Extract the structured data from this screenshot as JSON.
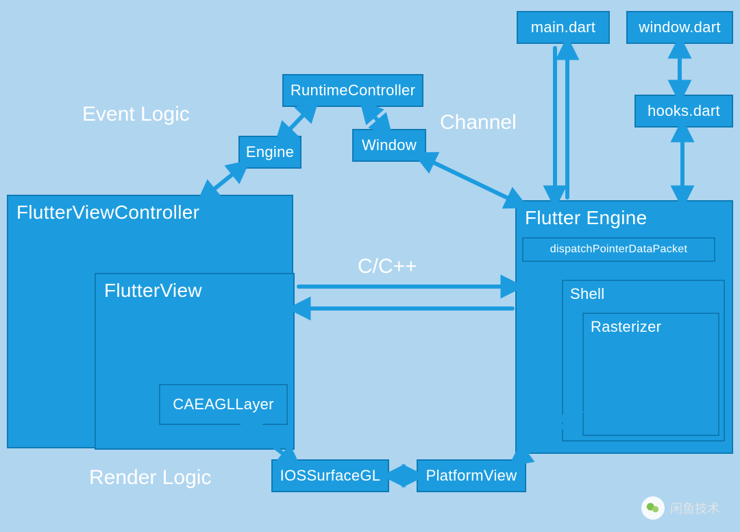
{
  "labels": {
    "event_logic": "Event Logic",
    "render_logic": "Render Logic",
    "channel": "Channel",
    "ccpp": "C/C++"
  },
  "nodes": {
    "flutter_view_controller": "FlutterViewController",
    "flutter_view": "FlutterView",
    "caeagllayer": "CAEAGLLayer",
    "engine": "Engine",
    "runtime_controller": "RuntimeController",
    "window": "Window",
    "iosurfacegl": "IOSSurfaceGL",
    "platform_view": "PlatformView",
    "flutter_engine": "Flutter Engine",
    "dispatch_pointer": "dispatchPointerDataPacket",
    "shell": "Shell",
    "rasterizer": "Rasterizer",
    "main_dart": "main.dart",
    "window_dart": "window.dart",
    "hooks_dart": "hooks.dart"
  },
  "watermark": "闲鱼技术",
  "colors": {
    "bg": "#b0d5ef",
    "block": "#1c9cdf",
    "border": "#0f7ab5",
    "text": "#ffffff"
  },
  "edges": [
    {
      "from": "flutter_view_controller",
      "to": "engine",
      "bidir": true
    },
    {
      "from": "engine",
      "to": "runtime_controller",
      "bidir": true
    },
    {
      "from": "runtime_controller",
      "to": "window",
      "bidir": true
    },
    {
      "from": "window",
      "to": "flutter_engine",
      "bidir": true,
      "label": "Channel"
    },
    {
      "from": "flutter_view",
      "to": "flutter_engine",
      "bidir": true,
      "label": "C/C++"
    },
    {
      "from": "caeagllayer",
      "to": "iosurfacegl",
      "bidir": true
    },
    {
      "from": "iosurfacegl",
      "to": "platform_view",
      "bidir": true
    },
    {
      "from": "platform_view",
      "to": "shell",
      "bidir": true
    },
    {
      "from": "main_dart",
      "to": "flutter_engine",
      "bidir": true
    },
    {
      "from": "window_dart",
      "to": "hooks_dart",
      "bidir": true
    },
    {
      "from": "hooks_dart",
      "to": "flutter_engine",
      "bidir": true
    }
  ]
}
